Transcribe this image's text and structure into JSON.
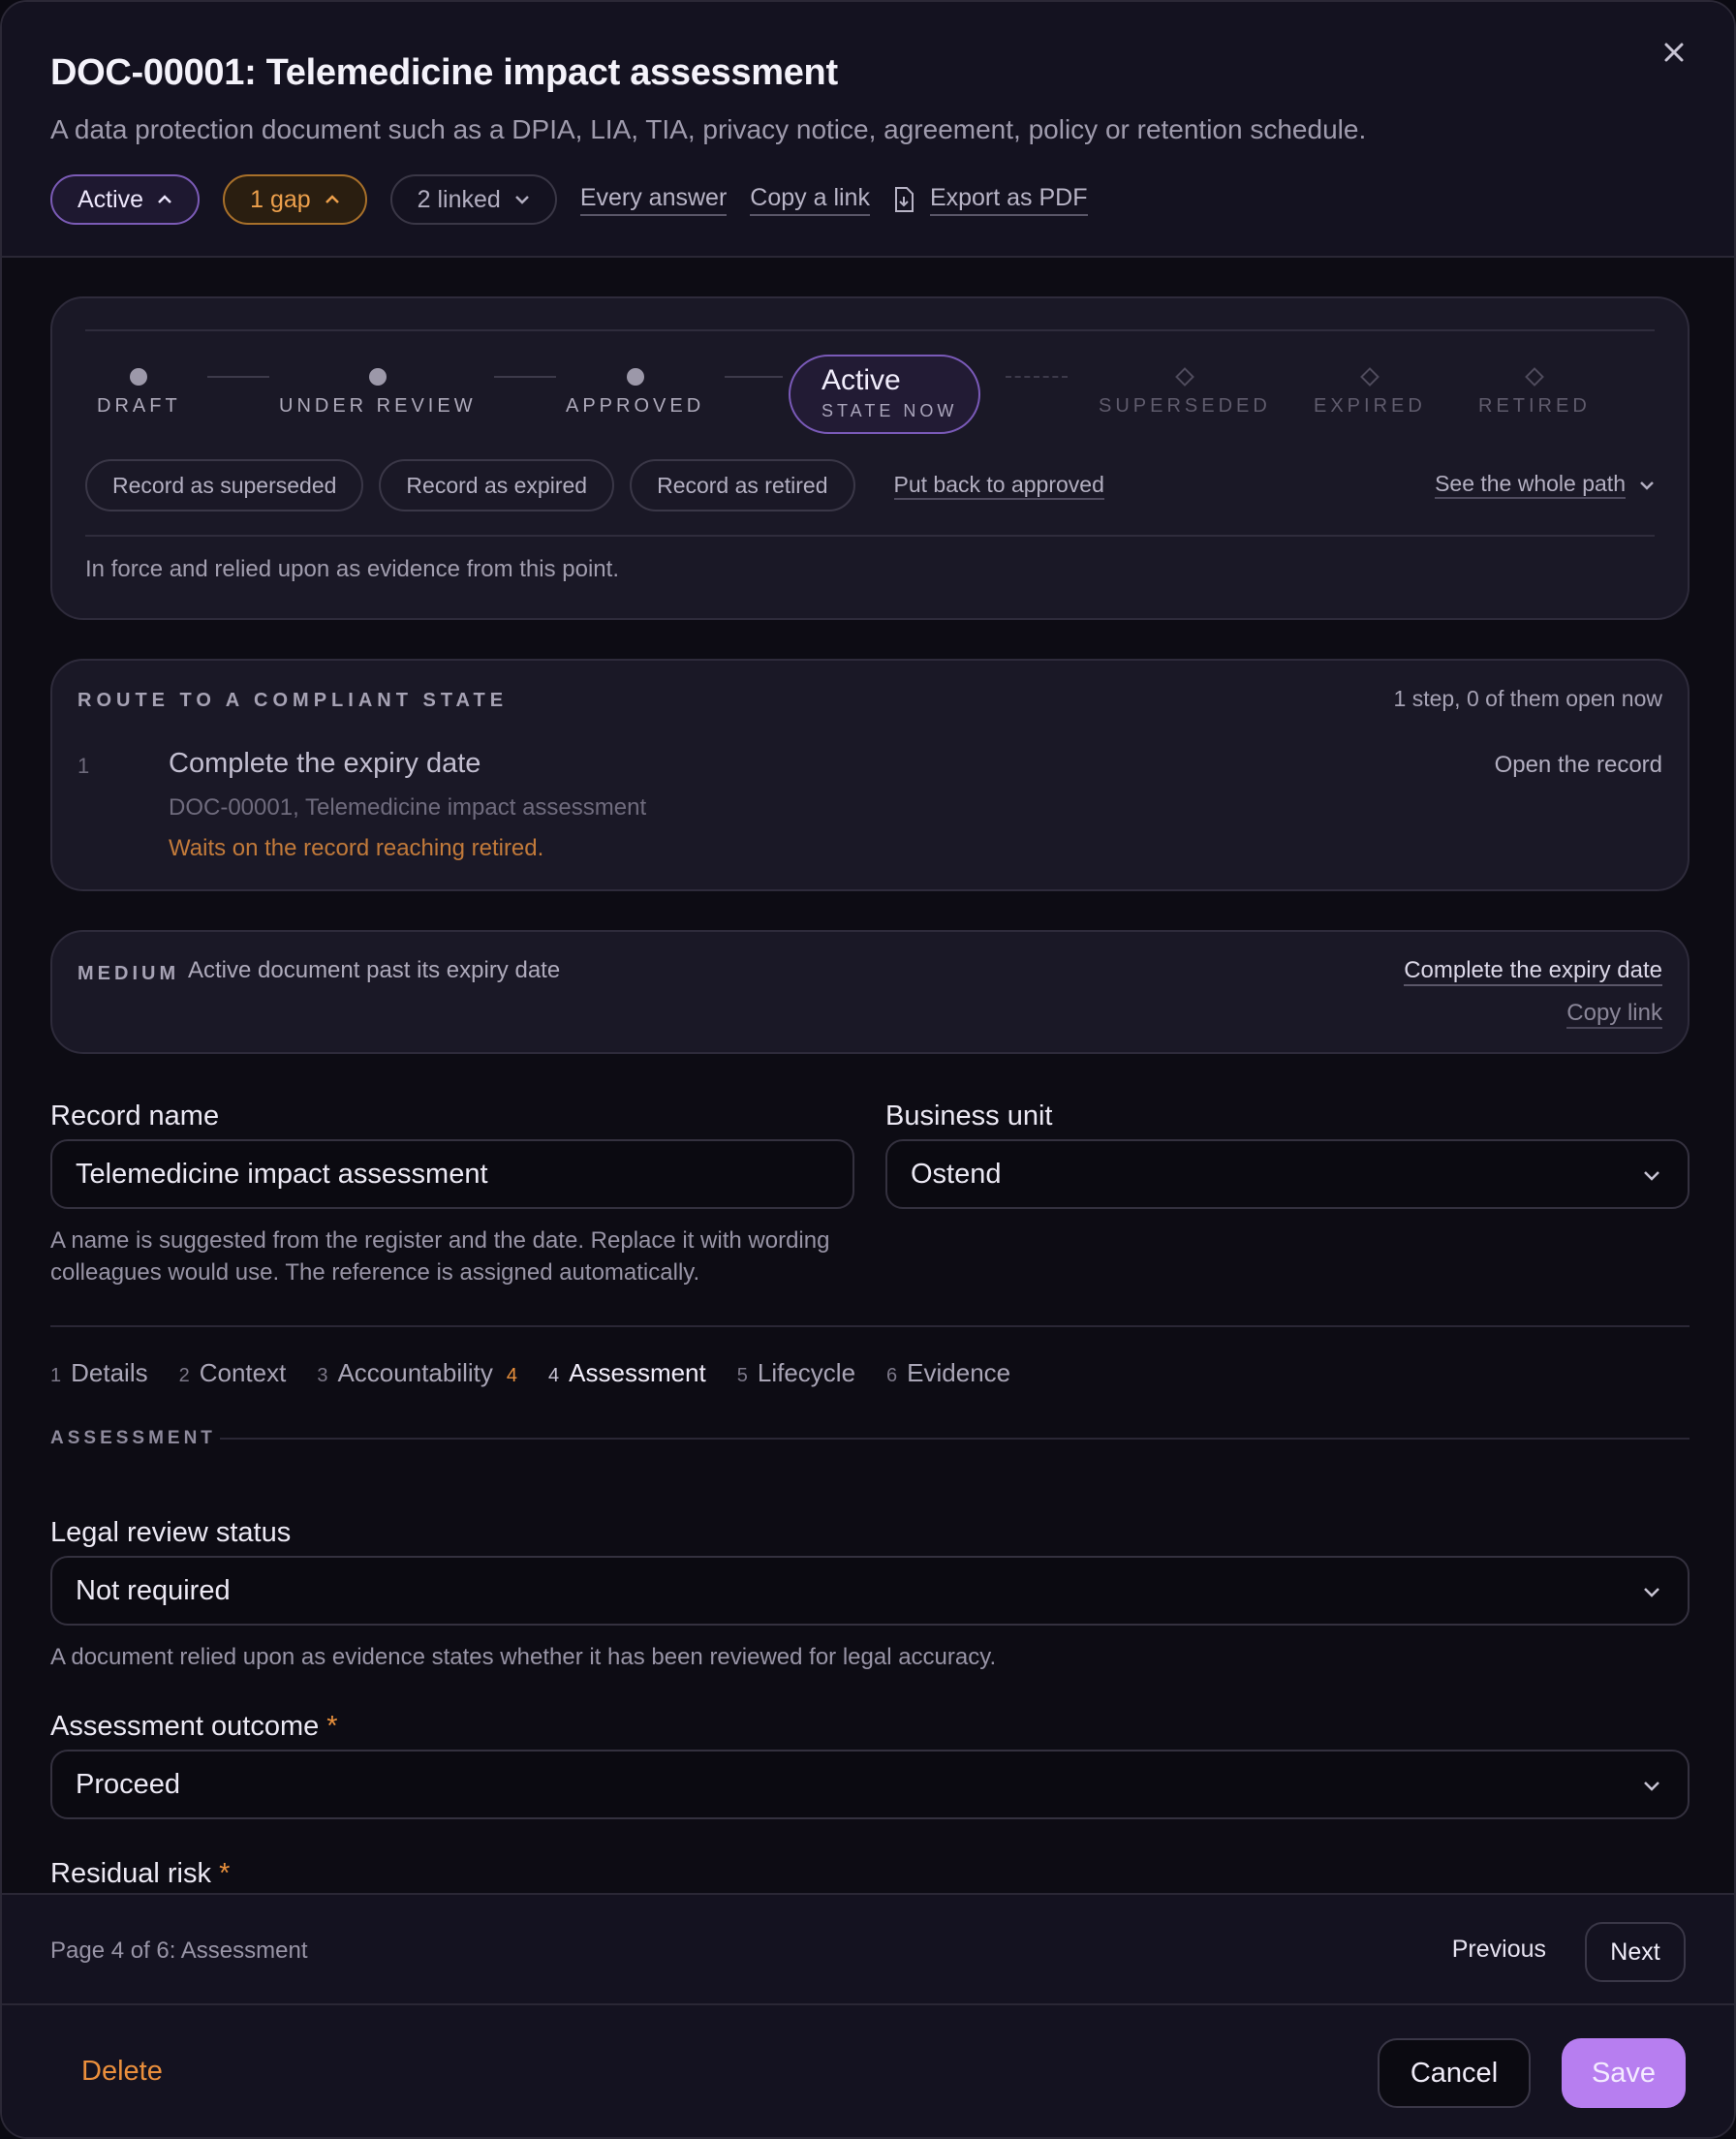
{
  "header": {
    "title": "DOC-00001: Telemedicine impact assessment",
    "subtitle": "A data protection document such as a DPIA, LIA, TIA, privacy notice, agreement, policy or retention schedule.",
    "status_chip": "Active",
    "gap_chip": "1 gap",
    "linked_chip": "2 linked",
    "every_answer": "Every answer",
    "copy_link": "Copy a link",
    "export_pdf": "Export as PDF"
  },
  "lifecycle": {
    "steps": [
      {
        "label": "DRAFT",
        "state": "done"
      },
      {
        "label": "UNDER REVIEW",
        "state": "done"
      },
      {
        "label": "APPROVED",
        "state": "done"
      },
      {
        "label": "SUPERSEDED",
        "state": "future"
      },
      {
        "label": "EXPIRED",
        "state": "future"
      },
      {
        "label": "RETIRED",
        "state": "future"
      }
    ],
    "current": "Active",
    "current_caption": "STATE NOW",
    "actions": [
      "Record as superseded",
      "Record as expired",
      "Record as retired"
    ],
    "put_back": "Put back to approved",
    "see_path": "See the whole path",
    "note": "In force and relied upon as evidence from this point."
  },
  "route": {
    "heading": "ROUTE TO A COMPLIANT STATE",
    "count": "1 step, 0 of them open now",
    "step_number": "1",
    "step_title": "Complete the expiry date",
    "step_ref": "DOC-00001, Telemedicine impact assessment",
    "step_wait": "Waits on the record reaching retired.",
    "open_record": "Open the record"
  },
  "issue": {
    "severity": "MEDIUM",
    "text": "Active document past its expiry date",
    "action": "Complete the expiry date",
    "copy": "Copy link"
  },
  "form": {
    "record_name_label": "Record name",
    "record_name_value": "Telemedicine impact assessment",
    "record_name_help": "A name is suggested from the register and the date. Replace it with wording colleagues would use. The reference is assigned automatically.",
    "business_unit_label": "Business unit",
    "business_unit_value": "Ostend",
    "tabs": [
      {
        "n": "1",
        "label": "Details",
        "badge": ""
      },
      {
        "n": "2",
        "label": "Context",
        "badge": ""
      },
      {
        "n": "3",
        "label": "Accountability",
        "badge": "4"
      },
      {
        "n": "4",
        "label": "Assessment",
        "badge": ""
      },
      {
        "n": "5",
        "label": "Lifecycle",
        "badge": ""
      },
      {
        "n": "6",
        "label": "Evidence",
        "badge": ""
      }
    ],
    "section": "ASSESSMENT",
    "legal_label": "Legal review status",
    "legal_value": "Not required",
    "legal_help": "A document relied upon as evidence states whether it has been reviewed for legal accuracy.",
    "outcome_label": "Assessment outcome",
    "outcome_value": "Proceed",
    "residual_label": "Residual risk",
    "required_mark": "*"
  },
  "pager": {
    "info": "Page 4 of 6: Assessment",
    "previous": "Previous",
    "next": "Next"
  },
  "footer": {
    "delete": "Delete",
    "cancel": "Cancel",
    "save": "Save"
  }
}
